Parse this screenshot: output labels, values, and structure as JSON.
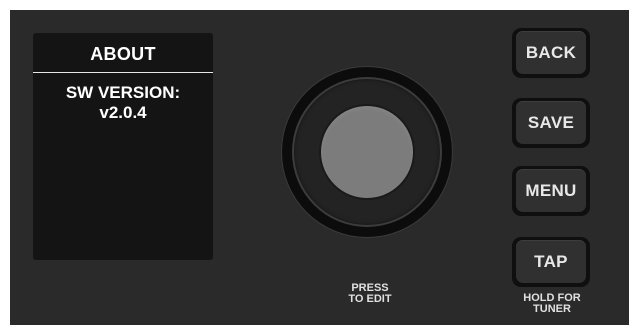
{
  "display": {
    "title": "ABOUT",
    "line1": "SW VERSION:",
    "line2": "v2.0.4"
  },
  "knob": {
    "label_line1": "PRESS",
    "label_line2": "TO EDIT"
  },
  "buttons": {
    "back": "BACK",
    "save": "SAVE",
    "menu": "MENU",
    "tap": "TAP"
  },
  "tap_hold_label": {
    "line1": "HOLD FOR",
    "line2": "TUNER"
  },
  "colors": {
    "panel": "#2a2a2b",
    "screen": "#141414",
    "knob_cap": "#7c7c7c",
    "button_face": "#303030",
    "text": "#ffffff"
  }
}
